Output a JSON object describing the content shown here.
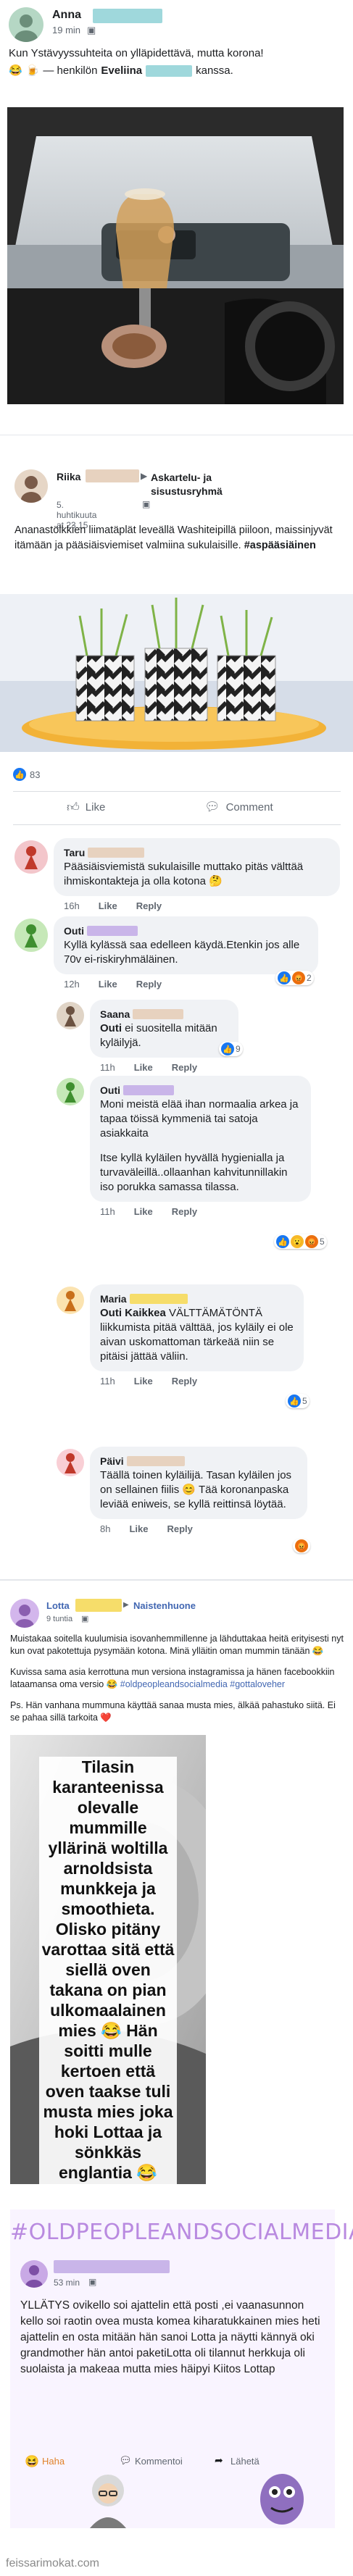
{
  "post1": {
    "author": "Anna",
    "time": "19 min",
    "text_line1": "Kun Ystävyyssuhteita on ylläpidettävä, mutta korona!",
    "text_line2_prefix": "— henkilön",
    "tagged": "Eveliina",
    "text_line2_suffix": "kanssa."
  },
  "post2": {
    "author": "Riika",
    "group": "Askartelu- ja sisustusryhmä",
    "time": "5. huhtikuuta at 23.15",
    "text": "Ananastölkkien liimatäplät leveällä Washiteipillä piiloon, maissinjyvät itämään ja pääsiäisviemiset valmiina sukulaisille.",
    "hashtag": "#aspääsiäinen",
    "reaction_count": "83",
    "like_label": "Like",
    "comment_label": "Comment"
  },
  "comments": [
    {
      "name": "Taru",
      "text": "Pääsiäisviemistä sukulaisille muttako pitäs välttää ihmiskontakteja ja olla kotona",
      "time": "16h",
      "like": "Like",
      "reply": "Reply"
    },
    {
      "name": "Outi",
      "text": "Kyllä kylässä saa edelleen käydä.Etenkin jos alle 70v ei-riskiryhmäläinen.",
      "time": "12h",
      "like": "Like",
      "reply": "Reply",
      "count": "2"
    },
    {
      "name": "Saana",
      "mention": "Outi",
      "text": "ei suositella mitään kyläilyjä.",
      "time": "11h",
      "like": "Like",
      "reply": "Reply",
      "count": "9"
    },
    {
      "name": "Outi",
      "text_p1": "Moni meistä elää ihan normaalia arkea ja tapaa töissä kymmeniä tai satoja asiakkaita",
      "text_p2": "Itse kyllä kyläilen hyvällä hygienialla ja turvaväleillä..ollaanhan kahvitunnillakin iso porukka samassa tilassa.",
      "time": "11h",
      "like": "Like",
      "reply": "Reply",
      "count": "5"
    },
    {
      "name": "Maria",
      "mention": "Outi Kaikkea",
      "text": "VÄLTTÄMÄTÖNTÄ liikkumista pitää välttää, jos kyläily ei ole aivan uskomattoman tärkeää niin se pitäisi jättää väliin.",
      "time": "11h",
      "like": "Like",
      "reply": "Reply",
      "count": "5"
    },
    {
      "name": "Päivi",
      "text": "Täällä toinen kyläilijä. Tasan kyläilen jos on sellainen fiilis 😊 Tää koronanpaska leviää eniweis, se kyllä reittinsä löytää.",
      "time": "8h",
      "like": "Like",
      "reply": "Reply"
    }
  ],
  "post3": {
    "author": "Lotta",
    "arrow": "▶",
    "group": "Naistenhuone",
    "time": "9 tuntia",
    "para1": "Muistakaa soitella kuulumisia isovanhemmillenne ja lähduttakaa heitä erityisesti nyt kun ovat pakotettuja pysymään kotona. Minä ylläitin oman mummin tänään 😂",
    "para2_prefix": "Kuvissa sama asia kerrottuna mun versiona instagramissa ja hänen facebookkiin lataamansa oma versio 😂",
    "para2_tags": "#oldpeopleandsocialmedia #gottaloveher",
    "para3": "Ps. Hän vanhana mummuna käyttää sanaa musta mies, älkää pahastuko siitä. Ei se pahaa sillä tarkoita ❤️",
    "photo_caption": "Tilasin karanteenissa olevalle mummille yllärinä woltilla arnoldsista munkkeja ja smoothieta. Olisko pitäny varottaa sitä että siellä oven takana on pian ulkomaalainen mies 😂 Hän soitti mulle kertoen että oven taakse tuli musta mies joka hoki Lottaa ja sönkkäs englantia 😂 Mummi oli sanonu sille että \"joo minä grändmathöö ja karanteeni\", ottanu pussin ja vetäny oven kiinni 😂"
  },
  "inner_shot": {
    "hashtag": "#OLDPEOPLEANDSOCIALMEDIA",
    "time": "53 min",
    "text": "YLLÄTYS ovikello soi ajattelin että posti ,ei vaanasunnon kello soi raotin ovea musta komea kiharatukkainen mies heti ajattelin en osta mitään hän sanoi Lotta ja näytti kännyä oki grandmother hän antoi paketiLotta oli tilannut herkkuja oli suolaista ja makeaa mutta mies häipyi Kiitos Lottap",
    "haha": "Haha",
    "comment": "Kommentoi",
    "share": "Lähetä"
  },
  "watermark": "feissarimokat.com",
  "colors": {
    "link": "#4267b2",
    "name_blur_teal": "#9fd8dc",
    "name_blur_purple": "#c9b5e9",
    "like_blue": "#1877f2",
    "haha_yellow": "#f7b928",
    "angry_orange": "#e9710f"
  }
}
